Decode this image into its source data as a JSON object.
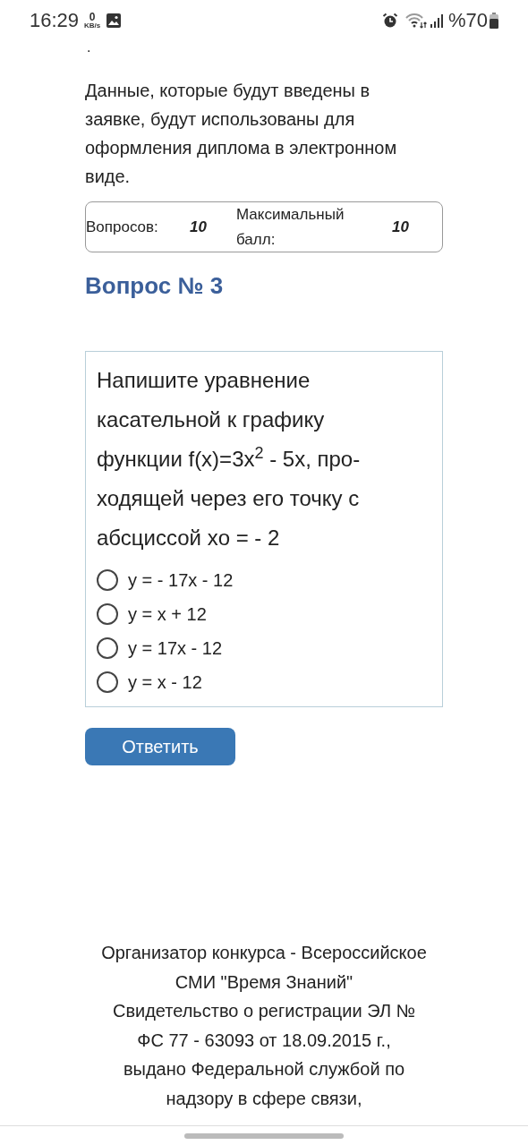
{
  "status_bar": {
    "time": "16:29",
    "net_speed_value": "0",
    "net_speed_unit": "KB/s",
    "battery": "%70"
  },
  "fragment": ".",
  "notice_lines": [
    "Данные, которые будут введены в",
    "заявке, будут использованы для",
    "оформления диплома в электронном",
    "виде."
  ],
  "info": {
    "questions_label": "Вопросов:",
    "questions_value": "10",
    "max_label_lines": [
      "Максимальный",
      "балл:"
    ],
    "max_value": "10"
  },
  "question_title": "Вопрос № 3",
  "question_lines": [
    "Напишите уравнение",
    "касательной к графику",
    "функции f(x)=3x$^{2}$ - 5x, про-",
    "ходящей через его точку с",
    "абсциссой xo = - 2"
  ],
  "options": [
    {
      "label": "y = - 17x - 12",
      "selected": false
    },
    {
      "label": "y = x + 12",
      "selected": false
    },
    {
      "label": "y = 17x - 12",
      "selected": false
    },
    {
      "label": "y = x - 12",
      "selected": false
    }
  ],
  "answer_button": "Ответить",
  "footer_lines": [
    "Организатор конкурса - Всероссийское",
    "СМИ \"Время Знаний\"",
    "Свидетельство о регистрации ЭЛ №",
    "ФС 77 - 63093 от 18.09.2015 г.,",
    "выдано Федеральной службой по",
    "надзору в сфере связи,"
  ]
}
